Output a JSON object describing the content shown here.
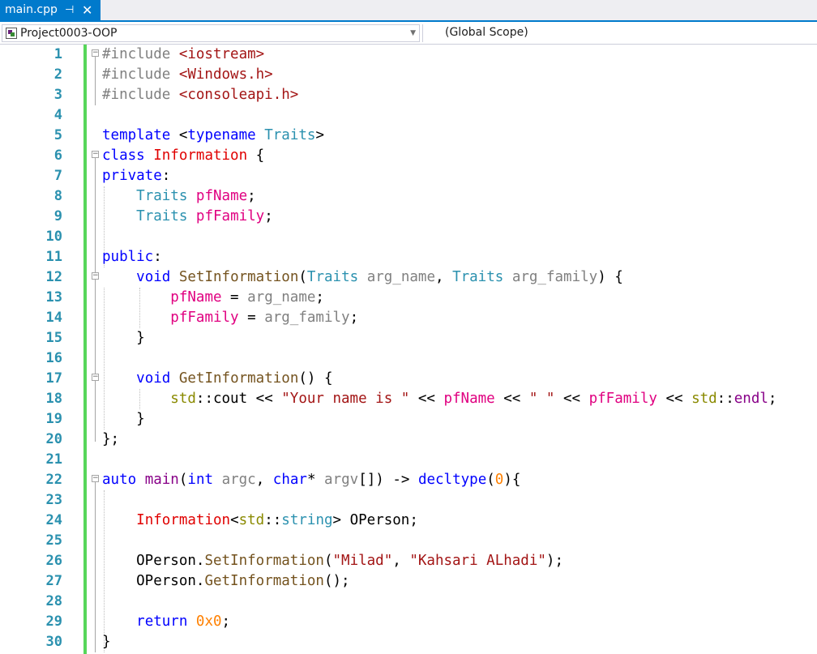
{
  "tab": {
    "title": "main.cpp",
    "pin_glyph": "⊣",
    "close_glyph": "✕"
  },
  "navbar": {
    "project": "Project0003-OOP",
    "scope": "(Global Scope)"
  },
  "lines": [
    {
      "n": "1",
      "t": "#include <iostream>"
    },
    {
      "n": "2",
      "t": "#include <Windows.h>"
    },
    {
      "n": "3",
      "t": "#include <consoleapi.h>"
    },
    {
      "n": "4",
      "t": ""
    },
    {
      "n": "5",
      "t": "template <typename Traits>"
    },
    {
      "n": "6",
      "t": "class Information {"
    },
    {
      "n": "7",
      "t": "private:"
    },
    {
      "n": "8",
      "t": "    Traits pfName;"
    },
    {
      "n": "9",
      "t": "    Traits pfFamily;"
    },
    {
      "n": "10",
      "t": ""
    },
    {
      "n": "11",
      "t": "public:"
    },
    {
      "n": "12",
      "t": "    void SetInformation(Traits arg_name, Traits arg_family) {"
    },
    {
      "n": "13",
      "t": "        pfName = arg_name;"
    },
    {
      "n": "14",
      "t": "        pfFamily = arg_family;"
    },
    {
      "n": "15",
      "t": "    }"
    },
    {
      "n": "16",
      "t": ""
    },
    {
      "n": "17",
      "t": "    void GetInformation() {"
    },
    {
      "n": "18",
      "t": "        std::cout << \"Your name is \" << pfName << \" \" << pfFamily << std::endl;"
    },
    {
      "n": "19",
      "t": "    }"
    },
    {
      "n": "20",
      "t": "};"
    },
    {
      "n": "21",
      "t": ""
    },
    {
      "n": "22",
      "t": "auto main(int argc, char* argv[]) -> decltype(0){"
    },
    {
      "n": "23",
      "t": ""
    },
    {
      "n": "24",
      "t": "    Information<std::string> OPerson;"
    },
    {
      "n": "25",
      "t": ""
    },
    {
      "n": "26",
      "t": "    OPerson.SetInformation(\"Milad\", \"Kahsari ALhadi\");"
    },
    {
      "n": "27",
      "t": "    OPerson.GetInformation();"
    },
    {
      "n": "28",
      "t": ""
    },
    {
      "n": "29",
      "t": "    return 0x0;"
    },
    {
      "n": "30",
      "t": "}"
    }
  ]
}
